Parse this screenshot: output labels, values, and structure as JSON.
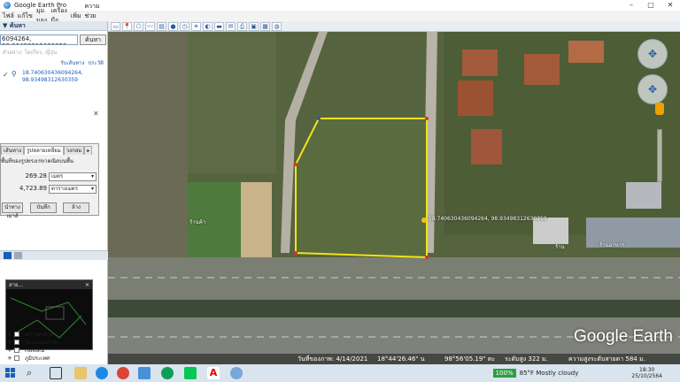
{
  "window": {
    "title": "Google Earth Pro",
    "minimize": "–",
    "maximize": "▢",
    "close": "✕"
  },
  "menu": [
    "ไฟล์",
    "แก้ไข",
    "มุมมอง",
    "เครื่องมือ",
    "เพิ่ม",
    "ความช่วยเหลือ"
  ],
  "search": {
    "section_title": "▼ ค้นหา",
    "value": "6094264, 98.93498312630359",
    "button": "ค้นหา",
    "hint": "ตัวอย่าง: โตเกียว, ญี่ปุ่น",
    "links": [
      "รับเส้นทาง",
      "ประวัติ"
    ],
    "result_text": "18.740630436094264, 98.93498312630359"
  },
  "measure": {
    "tabs": [
      "เส้นทาง",
      "รูปหลายเหลี่ยม",
      "วงกลม"
    ],
    "active_tab": "รูปหลายเหลี่ยม",
    "description": "พื้นที่ของรูปทรงเรขาคณิตบนพื้น",
    "perimeter": {
      "value": "269.28",
      "unit": "เมตร"
    },
    "area": {
      "value": "4,723.89",
      "unit": "ตารางเมตร"
    },
    "buttons": [
      "นำทางเมาส์",
      "บันทึก",
      "ล้าง"
    ]
  },
  "mini_window": {
    "title": "สาย..."
  },
  "layers": [
    "สภาพอากาศ",
    "ห้องแสดงภาพ",
    "เขตแดน",
    "ภูมิประเทศ"
  ],
  "map": {
    "placemark_label": "18.740630436094264, 98.93498312630359",
    "poi_labels": [
      "ร้านค้า",
      "ร้าน",
      "ร้านอาหาร"
    ],
    "logo": "Google Earth",
    "status": {
      "imagery_date": "วันที่ของภาพ: 4/14/2021",
      "lat": "18°44'26.46\" น",
      "lon": "98°56'05.19\" ตะ",
      "elev": "ระดับสูง 322 ม.",
      "eye": "ความสูงระดับสายตา 584 ม."
    }
  },
  "taskbar": {
    "battery": "100%",
    "weather": "85°F  Mostly cloudy",
    "time": "18:30",
    "date": "25/10/2564"
  },
  "colors": {
    "polygon": "#f2e21a",
    "accent": "#1a5fb4"
  }
}
